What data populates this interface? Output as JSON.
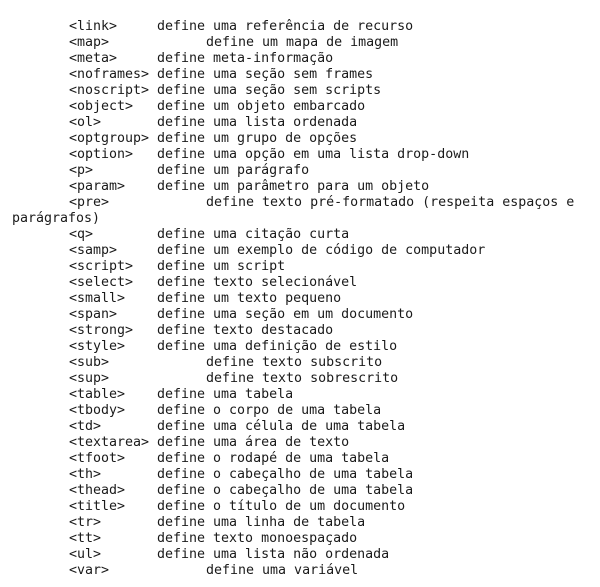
{
  "entries": [
    {
      "tag": "<link>",
      "desc": "define uma referência de recurso",
      "tab": false
    },
    {
      "tag": "<map>",
      "desc": "define um mapa de imagem",
      "tab": true
    },
    {
      "tag": "<meta>",
      "desc": "define meta-informação",
      "tab": false
    },
    {
      "tag": "<noframes>",
      "desc": "define uma seção sem frames",
      "tab": false
    },
    {
      "tag": "<noscript>",
      "desc": "define uma seção sem scripts",
      "tab": false
    },
    {
      "tag": "<object>",
      "desc": "define um objeto embarcado",
      "tab": false
    },
    {
      "tag": "<ol>",
      "desc": "define uma lista ordenada",
      "tab": false
    },
    {
      "tag": "<optgroup>",
      "desc": "define um grupo de opções",
      "tab": false
    },
    {
      "tag": "<option>",
      "desc": "define uma opção em uma lista drop-down",
      "tab": false
    },
    {
      "tag": "<p>",
      "desc": "define um parágrafo",
      "tab": false
    },
    {
      "tag": "<param>",
      "desc": "define um parâmetro para um objeto",
      "tab": false
    },
    {
      "tag": "<pre>",
      "desc": "define texto pré-formatado (respeita espaços e",
      "tab": true,
      "continuation": "parágrafos)"
    },
    {
      "tag": "<q>",
      "desc": "define uma citação curta",
      "tab": false
    },
    {
      "tag": "<samp>",
      "desc": "define um exemplo de código de computador",
      "tab": false
    },
    {
      "tag": "<script>",
      "desc": "define um script",
      "tab": false
    },
    {
      "tag": "<select>",
      "desc": "define texto selecionável",
      "tab": false
    },
    {
      "tag": "<small>",
      "desc": "define um texto pequeno",
      "tab": false
    },
    {
      "tag": "<span>",
      "desc": "define uma seção em um documento",
      "tab": false
    },
    {
      "tag": "<strong>",
      "desc": "define texto destacado",
      "tab": false
    },
    {
      "tag": "<style>",
      "desc": "define uma definição de estilo",
      "tab": false
    },
    {
      "tag": "<sub>",
      "desc": "define texto subscrito",
      "tab": true
    },
    {
      "tag": "<sup>",
      "desc": "define texto sobrescrito",
      "tab": true
    },
    {
      "tag": "<table>",
      "desc": "define uma tabela",
      "tab": false
    },
    {
      "tag": "<tbody>",
      "desc": "define o corpo de uma tabela",
      "tab": false
    },
    {
      "tag": "<td>",
      "desc": "define uma célula de uma tabela",
      "tab": false
    },
    {
      "tag": "<textarea>",
      "desc": "define uma área de texto",
      "tab": false
    },
    {
      "tag": "<tfoot>",
      "desc": "define o rodapé de uma tabela",
      "tab": false
    },
    {
      "tag": "<th>",
      "desc": "define o cabeçalho de uma tabela",
      "tab": false
    },
    {
      "tag": "<thead>",
      "desc": "define o cabeçalho de uma tabela",
      "tab": false
    },
    {
      "tag": "<title>",
      "desc": "define o título de um documento",
      "tab": false
    },
    {
      "tag": "<tr>",
      "desc": "define uma linha de tabela",
      "tab": false
    },
    {
      "tag": "<tt>",
      "desc": "define texto monoespaçado",
      "tab": false
    },
    {
      "tag": "<ul>",
      "desc": "define uma lista não ordenada",
      "tab": false
    },
    {
      "tag": "<var>",
      "desc": "define uma variável",
      "tab": true
    }
  ]
}
